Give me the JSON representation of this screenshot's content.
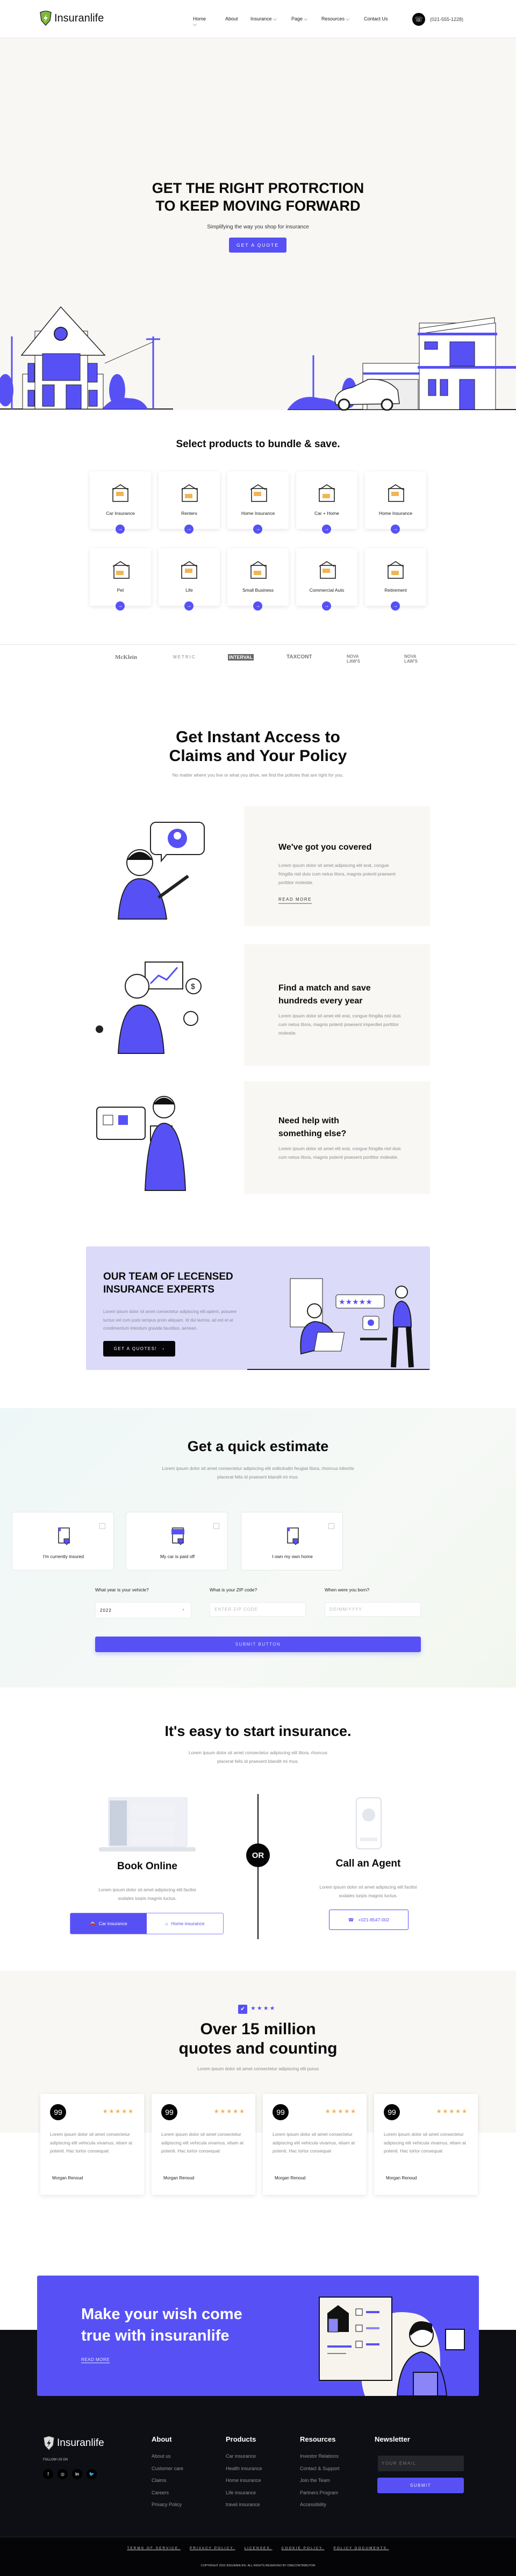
{
  "brand": {
    "name": "Insuranlife",
    "accent": "#5751f5",
    "dark": "#0d0f14"
  },
  "header": {
    "nav": [
      {
        "label": "Home",
        "dropdown": true
      },
      {
        "label": "About",
        "dropdown": false
      },
      {
        "label": "Insurance",
        "dropdown": true
      },
      {
        "label": "Page",
        "dropdown": true
      },
      {
        "label": "Resources",
        "dropdown": true
      },
      {
        "label": "Contact Us",
        "dropdown": false
      }
    ],
    "phone": "(021-555-1228)",
    "phone_icon": "phone-icon"
  },
  "hero": {
    "title_line1": "GET THE RIGHT PROTRCTION",
    "title_line2": "TO KEEP MOVING FORWARD",
    "subtitle": "Simplifying the way you shop for insurance",
    "cta": "GET A QUOTE"
  },
  "products": {
    "title": "Select products to bundle & save.",
    "items": [
      {
        "label": "Car Insurance",
        "icon": "car-icon"
      },
      {
        "label": "Renters",
        "icon": "house-icon"
      },
      {
        "label": "Home Insurance",
        "icon": "building-icon"
      },
      {
        "label": "Car + Home",
        "icon": "car-home-icon"
      },
      {
        "label": "Home Insurance",
        "icon": "building-icon"
      },
      {
        "label": "Pet",
        "icon": "dog-icon"
      },
      {
        "label": "Life",
        "icon": "life-shield-icon"
      },
      {
        "label": "Small Business",
        "icon": "desk-icon"
      },
      {
        "label": "Commercial Auto",
        "icon": "truck-icon"
      },
      {
        "label": "Retirement",
        "icon": "rocking-chair-icon"
      }
    ]
  },
  "logos": [
    "McKlein",
    "METRIC",
    "INTERVAL",
    "TAXCONT",
    "NOVA LAW'S",
    "NOVA LAW'S"
  ],
  "access": {
    "title_line1": "Get Instant Access to",
    "title_line2": "Claims and Your Policy",
    "subtitle": "No matter where you live or what you drive, we find the policies that are right for you.",
    "features": [
      {
        "title": "We've got you covered",
        "body": "Lorem ipsum dolor sit amet adipiscing elit erat, congue fringilla nisl duis cum netus litora, magnis potenti praesent porttitor molestie.",
        "link": "READ MORE"
      },
      {
        "title": "Find a match and save hundreds every year",
        "body": "Lorem ipsum dolor sit amet elit erat, congue fringilla nisl duis cum netus litora, magnis potenti praesent imperdiet porttitor molestie."
      },
      {
        "title": "Need help with something else?",
        "body": "Lorem ipsum dolor sit amet elit erat, congue fringilla nisl duis cum netus litora, magnis potenti praesent porttitor molestie."
      }
    ]
  },
  "team": {
    "title_line1": "OUR TEAM OF LECENSED",
    "title_line2": "INSURANCE EXPERTS",
    "body": "Lorem ipsum dolor sit amet consectetur adipiscing elit aptent, posuere luctus vel cum justo  tempus proin aliquam. Id dui  lacinia, ad est et at condimentum interdum gravida faucibus, aenean.",
    "cta": "GET A QUOTES!",
    "bg": "#dcdaf9"
  },
  "estimate": {
    "title": "Get a quick estimate",
    "subtitle": "Lorem ipsum dolor sit amet consectetur adipiscing elit sollicitudin feugiat litora, rhoncus lobortis placerat felis id praesent blandit mi mus.",
    "options": [
      {
        "label": "I'm currently insured",
        "checked": false
      },
      {
        "label": "My car is paid off",
        "checked": false
      },
      {
        "label": "I own my own home",
        "checked": false
      }
    ],
    "fields": [
      {
        "label": "What year is your vehicle?",
        "value": "2022"
      },
      {
        "label": "What is your ZIP code?",
        "placeholder": "ENTER ZIP CODE"
      },
      {
        "label": "When were you born?",
        "placeholder": "DD/MM/YYYY"
      }
    ],
    "submit": "SUBMIT BUTTON"
  },
  "easy": {
    "title": "It's easy to start insurance.",
    "subtitle": "Lorem ipsum dolor sit amet consectetur adipiscing elit  litora, rhoncus placerat felis id praesent blandit mi mus.",
    "or": "OR",
    "online": {
      "title": "Book Online",
      "body": "Lorem ipsum dolor sit amet adipiscing elit facilisi  sodales turpis magnis luctus.",
      "tabs": [
        "Car insurance",
        "Home insurance"
      ]
    },
    "agent": {
      "title": "Call an Agent",
      "body": "Lorem ipsum dolor sit amet adipiscing elit facilisi  sodales turpis magnis luctus.",
      "phone": "+021-8547-002"
    }
  },
  "stats": {
    "rating_stars": 4,
    "title_line1": "Over 15 million",
    "title_line2": "quotes and counting",
    "subtitle": "Lorem ipsum dolor sit amet consectetur adipiscing elit purus",
    "testimonials": [
      {
        "text": "Lorem ipsum dolor sit amet consectetur adipiscing elit  vehicula vivamus, etiam at  potenti. Hac tortor consequat",
        "name": "Morgan Renoud",
        "stars": 5
      },
      {
        "text": "Lorem ipsum dolor sit amet consectetur adipiscing elit  vehicula vivamus, etiam at  potenti. Hac tortor consequat",
        "name": "Morgan Renoud",
        "stars": 5
      },
      {
        "text": "Lorem ipsum dolor sit amet consectetur adipiscing elit  vehicula vivamus, etiam at  potenti. Hac tortor consequat",
        "name": "Morgan Renoud",
        "stars": 5
      },
      {
        "text": "Lorem ipsum dolor sit amet consectetur adipiscing elit  vehicula vivamus, etiam at  potenti. Hac tortor consequat",
        "name": "Morgan Renoud",
        "stars": 5
      }
    ]
  },
  "cta": {
    "title_line1": "Make your wish come",
    "title_line2": "true with insuranlife",
    "link": "READ MORE"
  },
  "footer": {
    "follow": "FOLLOW US ON",
    "social": [
      "f",
      "ig",
      "in",
      "tw"
    ],
    "columns": [
      {
        "title": "About",
        "links": [
          "About us",
          "Customer care",
          "Claims",
          "Careers",
          "Privacy Policy"
        ]
      },
      {
        "title": "Products",
        "links": [
          "Car insurance",
          "Health insurance",
          "Home insurance",
          "Life insurance",
          "travel insurance"
        ]
      },
      {
        "title": "Resources",
        "links": [
          "Investor Relations",
          "Contact & Support",
          "Join the Team",
          "Partners Program",
          "Accessibility"
        ]
      }
    ],
    "newsletter": {
      "title": "Newsletter",
      "placeholder": "YOUR EMAIL",
      "submit": "SUBMIT"
    },
    "legal": [
      "TERMS OF SERVICE.",
      "PRIVACY POLICY.",
      "LICENSES.",
      "COOKIE POLICY.",
      "POLICY DOCUMENTS."
    ],
    "copyright": "COPYRIGHT 2022 INSURANLIFE. ALL RIGHTS RESERVED BY ONECONTRIBUTOR"
  }
}
